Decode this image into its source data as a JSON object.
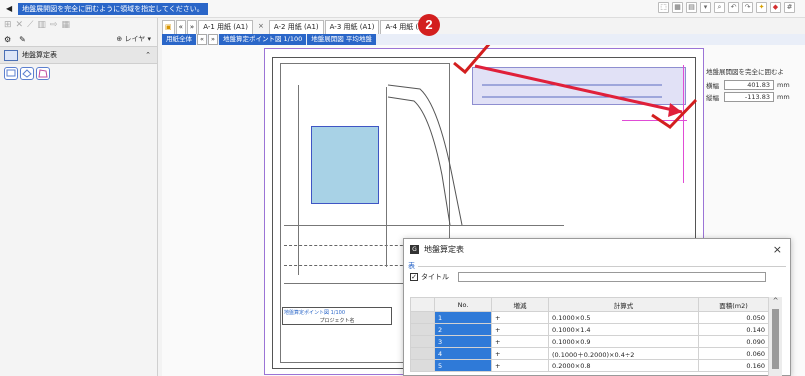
{
  "topbar": {
    "hint": "地盤展開図を完全に囲むように領域を指定してください。",
    "icons": [
      "select-icon",
      "window-icon",
      "screen-icon",
      "dropdown-icon",
      "zoom-icon",
      "undo-icon",
      "redo-icon",
      "bulb-icon",
      "color-icon",
      "grid-icon"
    ]
  },
  "left": {
    "layer_label": "レイヤ",
    "panel_title": "地盤算定表",
    "tools": [
      "rect-select-tool",
      "lasso-tool",
      "polygon-tool"
    ]
  },
  "tabs": {
    "nav_first": "«",
    "nav_next": "»",
    "items": [
      {
        "label": "A-1 用紙 (A1)"
      },
      {
        "label": "A-2 用紙 (A1)"
      },
      {
        "label": "A-3 用紙 (A1)"
      },
      {
        "label": "A-4 用紙 (A1"
      }
    ],
    "close": "×"
  },
  "subtabs": [
    {
      "label": "用紙全体"
    },
    {
      "label": "地盤算定ポイント図 1/100"
    },
    {
      "label": "地盤展開図 平均地盤"
    }
  ],
  "drawing": {
    "caption": "地盤算定ポイント図 1/100",
    "title_block": "プロジェクト名"
  },
  "info": {
    "message": "地盤展開図を完全に囲むよ",
    "rows": [
      {
        "label": "横幅",
        "value": "401.83",
        "unit": "mm"
      },
      {
        "label": "縦幅",
        "value": "-113.83",
        "unit": "mm"
      }
    ]
  },
  "badge": "2",
  "dialog": {
    "title": "地盤算定表",
    "close": "×",
    "section": "表",
    "title_check": "✓",
    "title_label": "タイトル",
    "headers": [
      "No.",
      "増減",
      "計算式",
      "面積(m2)"
    ],
    "rows": [
      {
        "no": "1",
        "sign": "+",
        "formula": "0.1000×0.5",
        "area": "0.050"
      },
      {
        "no": "2",
        "sign": "+",
        "formula": "0.1000×1.4",
        "area": "0.140"
      },
      {
        "no": "3",
        "sign": "+",
        "formula": "0.1000×0.9",
        "area": "0.090"
      },
      {
        "no": "4",
        "sign": "+",
        "formula": "(0.1000＋0.2000)×0.4÷2",
        "area": "0.060"
      },
      {
        "no": "5",
        "sign": "+",
        "formula": "0.2000×0.8",
        "area": "0.160"
      }
    ]
  },
  "colors": {
    "accent": "#2a66c8",
    "badge": "#d31f1f",
    "arrow": "#e0203a",
    "check": "#d31f1f",
    "building": "#a8d2e6",
    "magenta": "#e04cd6"
  }
}
